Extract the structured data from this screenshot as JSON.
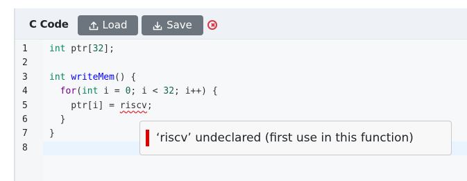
{
  "toolbar": {
    "title": "C Code",
    "load_label": "Load",
    "save_label": "Save",
    "close_icon": "close-circle-icon"
  },
  "editor": {
    "language": "C",
    "active_line": 8,
    "lines": [
      {
        "number": "1",
        "tokens": [
          {
            "t": "type",
            "v": "int"
          },
          {
            "t": "plain",
            "v": " ptr["
          },
          {
            "t": "num",
            "v": "32"
          },
          {
            "t": "plain",
            "v": "];"
          }
        ]
      },
      {
        "number": "2",
        "tokens": []
      },
      {
        "number": "3",
        "tokens": [
          {
            "t": "type",
            "v": "int"
          },
          {
            "t": "plain",
            "v": " "
          },
          {
            "t": "def",
            "v": "writeMem"
          },
          {
            "t": "plain",
            "v": "() {"
          }
        ]
      },
      {
        "number": "4",
        "tokens": [
          {
            "t": "plain",
            "v": "  "
          },
          {
            "t": "kw",
            "v": "for"
          },
          {
            "t": "plain",
            "v": "("
          },
          {
            "t": "type",
            "v": "int"
          },
          {
            "t": "plain",
            "v": " i = "
          },
          {
            "t": "num",
            "v": "0"
          },
          {
            "t": "plain",
            "v": "; i < "
          },
          {
            "t": "num",
            "v": "32"
          },
          {
            "t": "plain",
            "v": "; i++) {"
          }
        ]
      },
      {
        "number": "5",
        "tokens": [
          {
            "t": "plain",
            "v": "    ptr[i] = "
          },
          {
            "t": "err",
            "v": "riscv"
          },
          {
            "t": "plain",
            "v": ";"
          }
        ]
      },
      {
        "number": "6",
        "tokens": [
          {
            "t": "plain",
            "v": "  }"
          }
        ]
      },
      {
        "number": "7",
        "tokens": [
          {
            "t": "plain",
            "v": "}"
          }
        ]
      },
      {
        "number": "8",
        "tokens": []
      }
    ]
  },
  "lint": {
    "severity": "error",
    "message": "‘riscv’ undeclared (first use in this function)"
  },
  "colors": {
    "button_bg": "#6c757d",
    "close_icon": "#dc3545",
    "error_marker": "#e00000",
    "keyword": "#770088",
    "type": "#008855",
    "number": "#116644",
    "function_name": "#0000ff"
  }
}
